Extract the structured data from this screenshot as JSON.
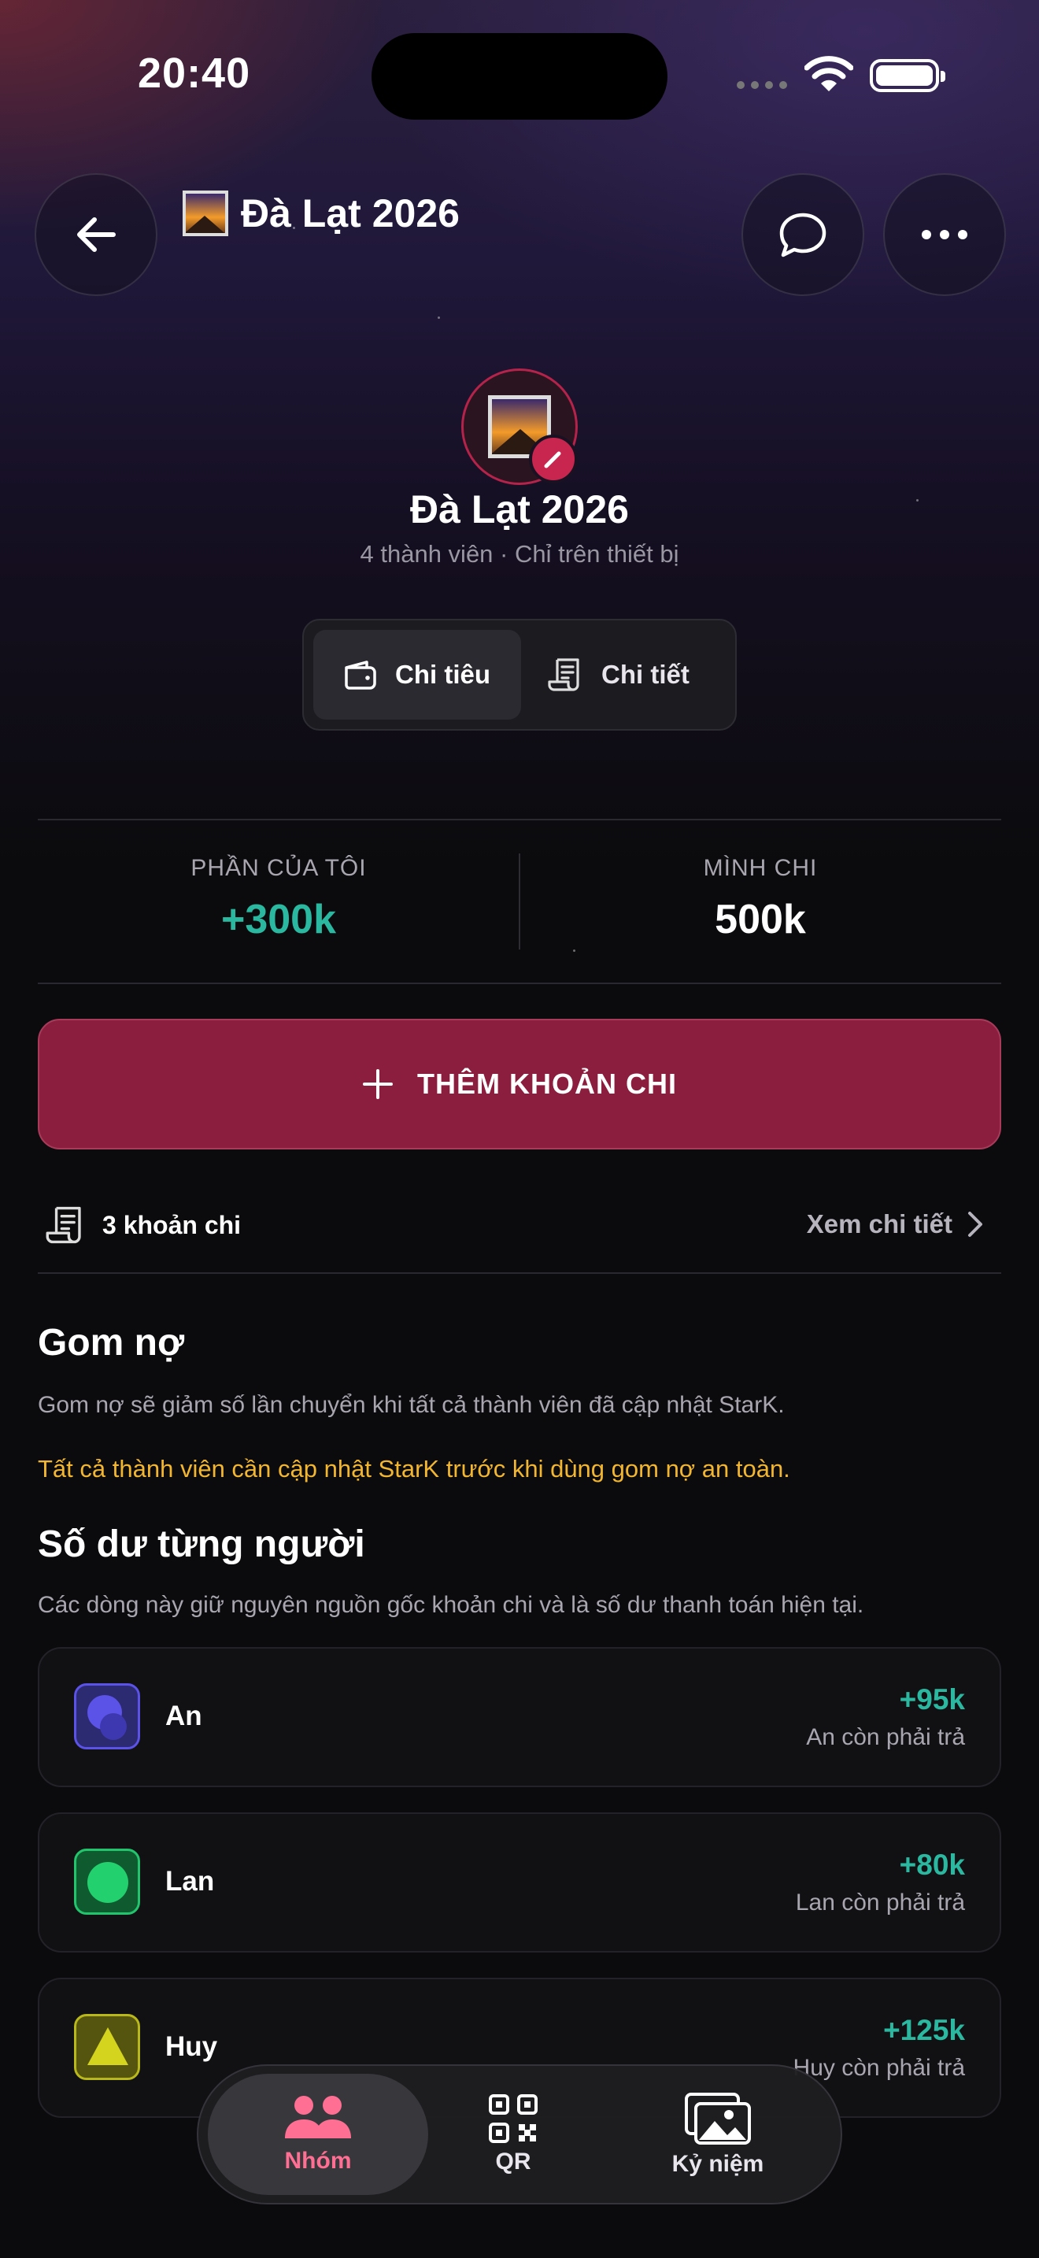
{
  "status": {
    "time": "20:40"
  },
  "header": {
    "title": "Đà Lạt 2026"
  },
  "group": {
    "name": "Đà Lạt 2026",
    "subtitle": "4 thành viên · Chỉ trên thiết bị"
  },
  "segments": [
    {
      "label": "Chi tiêu",
      "icon": "wallet-icon",
      "active": true
    },
    {
      "label": "Chi tiết",
      "icon": "receipt-icon",
      "active": false
    }
  ],
  "stats": {
    "my_share_label": "PHẦN CỦA TÔI",
    "my_share_value": "+300k",
    "i_paid_label": "MÌNH CHI",
    "i_paid_value": "500k"
  },
  "add_expense": {
    "label": "THÊM KHOẢN CHI"
  },
  "expenses_row": {
    "count_label": "3 khoản chi",
    "see_detail": "Xem chi tiết"
  },
  "consolidate": {
    "title": "Gom nợ",
    "description": "Gom nợ sẽ giảm số lần chuyển khi tất cả thành viên đã cập nhật StarK.",
    "warning": "Tất cả thành viên cần cập nhật StarK trước khi dùng gom nợ an toàn."
  },
  "balances": {
    "title": "Số dư từng người",
    "description": "Các dòng này giữ nguyên nguồn gốc khoản chi và là số dư thanh toán hiện tại.",
    "members": [
      {
        "name": "An",
        "amount": "+95k",
        "note": "An còn phải trả",
        "color": "#4f46e5"
      },
      {
        "name": "Lan",
        "amount": "+80k",
        "note": "Lan còn phải trả",
        "color": "#22c56e"
      },
      {
        "name": "Huy",
        "amount": "+125k",
        "note": "Huy còn phải trả",
        "color": "#b8b81a"
      }
    ]
  },
  "tabbar": [
    {
      "label": "Nhóm",
      "icon": "group-icon",
      "active": true
    },
    {
      "label": "QR",
      "icon": "qr-code-icon",
      "active": false
    },
    {
      "label": "Kỷ niệm",
      "icon": "photos-icon",
      "active": false
    }
  ],
  "colors": {
    "accent": "#8b1e3e",
    "positive": "#2ab9a0",
    "warning": "#f2b630",
    "tab_active": "#ff6f93"
  }
}
